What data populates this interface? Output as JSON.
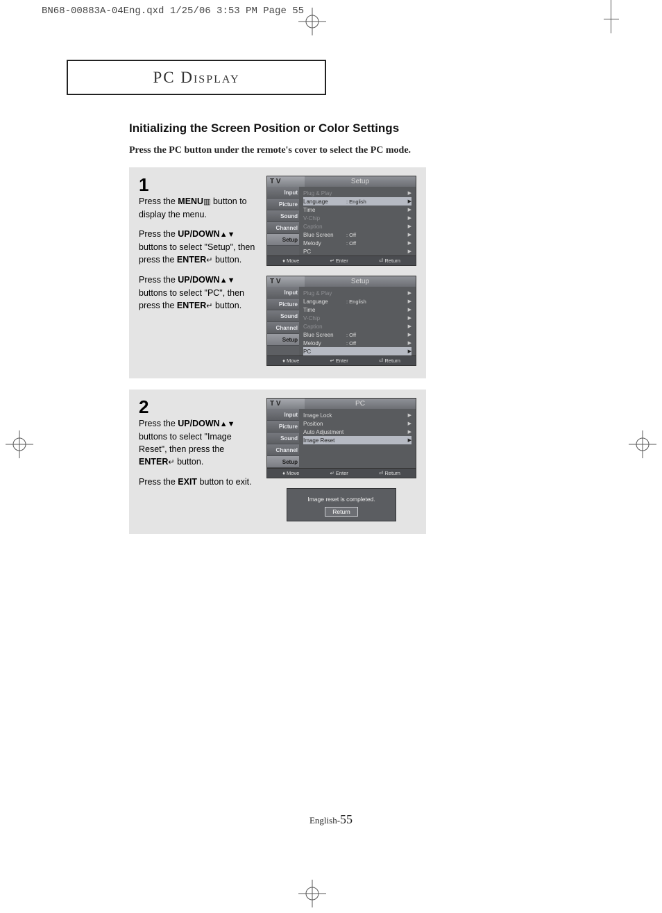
{
  "print_header": "BN68-00883A-04Eng.qxd  1/25/06 3:53 PM  Page 55",
  "section_title": "PC Display",
  "heading": "Initializing the Screen Position or Color Settings",
  "intro": "Press the PC button under the remote's cover to select the PC mode.",
  "glyphs": {
    "menu": "▥",
    "updown": "▲▼",
    "enter": "↵",
    "move": "♦",
    "return": "⏎"
  },
  "step1": {
    "num": "1",
    "p1a": "Press the ",
    "p1b": "MENU",
    "p1c": " button to display the menu.",
    "p2a": "Press the ",
    "p2b": "UP/DOWN",
    "p2c": " buttons to select \"Setup\", then press the ",
    "p2d": "ENTER",
    "p2e": " button.",
    "p3a": "Press the ",
    "p3b": "UP/DOWN",
    "p3c": " buttons to select \"PC\", then press the ",
    "p3d": "ENTER",
    "p3e": " button."
  },
  "step2": {
    "num": "2",
    "p1a": "Press the ",
    "p1b": "UP/DOWN",
    "p1c": " buttons to select \"Image Reset\", then press the ",
    "p1d": "ENTER",
    "p1e": " button.",
    "p2a": "Press the ",
    "p2b": "EXIT",
    "p2c": " button to exit."
  },
  "osd": {
    "tv": "T V",
    "tabs": [
      "Input",
      "Picture",
      "Sound",
      "Channel",
      "Setup"
    ],
    "title_setup": "Setup",
    "title_pc": "PC",
    "foot_move": "Move",
    "foot_enter": "Enter",
    "foot_return": "Return"
  },
  "osd1": {
    "rows": [
      {
        "label": "Plug & Play",
        "val": "",
        "dim": true
      },
      {
        "label": "Language",
        "val": ": English",
        "hl": true
      },
      {
        "label": "Time",
        "val": ""
      },
      {
        "label": "V-Chip",
        "val": "",
        "dim": true
      },
      {
        "label": "Caption",
        "val": "",
        "dim": true
      },
      {
        "label": "Blue Screen",
        "val": ": Off"
      },
      {
        "label": "Melody",
        "val": ": Off"
      },
      {
        "label": "PC",
        "val": ""
      }
    ]
  },
  "osd2": {
    "rows": [
      {
        "label": "Plug & Play",
        "val": "",
        "dim": true
      },
      {
        "label": "Language",
        "val": ": English"
      },
      {
        "label": "Time",
        "val": ""
      },
      {
        "label": "V-Chip",
        "val": "",
        "dim": true
      },
      {
        "label": "Caption",
        "val": "",
        "dim": true
      },
      {
        "label": "Blue Screen",
        "val": ": Off"
      },
      {
        "label": "Melody",
        "val": ": Off"
      },
      {
        "label": "PC",
        "val": "",
        "hl": true
      }
    ]
  },
  "osd3": {
    "rows": [
      {
        "label": "Image Lock",
        "val": ""
      },
      {
        "label": "Position",
        "val": ""
      },
      {
        "label": "Auto Adjustment",
        "val": ""
      },
      {
        "label": "Image Reset",
        "val": "",
        "hl": true
      }
    ]
  },
  "popup": {
    "msg": "Image reset is completed.",
    "btn": "Return"
  },
  "footer": {
    "lang": "English-",
    "page": "55"
  }
}
